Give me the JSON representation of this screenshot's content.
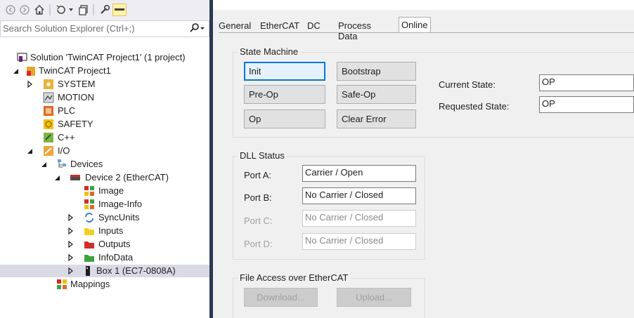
{
  "explorer": {
    "search_placeholder": "Search Solution Explorer (Ctrl+;)",
    "toolbar_icons": [
      "back-icon",
      "forward-icon",
      "home-icon",
      "sync-icon",
      "dropdown-arrow-icon",
      "show-all-files-icon",
      "properties-icon",
      "preview-icon"
    ],
    "tree": [
      {
        "label": "Solution 'TwinCAT Project1' (1 project)",
        "icon": "solution-icon",
        "arrow": "none"
      },
      {
        "label": "TwinCAT Project1",
        "icon": "twincat-project-icon",
        "arrow": "expanded"
      },
      {
        "label": "SYSTEM",
        "icon": "system-icon",
        "arrow": "collapsed"
      },
      {
        "label": "MOTION",
        "icon": "motion-icon",
        "arrow": "none"
      },
      {
        "label": "PLC",
        "icon": "plc-icon",
        "arrow": "none"
      },
      {
        "label": "SAFETY",
        "icon": "safety-icon",
        "arrow": "none"
      },
      {
        "label": "C++",
        "icon": "cpp-icon",
        "arrow": "none"
      },
      {
        "label": "I/O",
        "icon": "io-icon",
        "arrow": "expanded"
      },
      {
        "label": "Devices",
        "icon": "devices-icon",
        "arrow": "expanded"
      },
      {
        "label": "Device 2 (EtherCAT)",
        "icon": "ethercat-device-icon",
        "arrow": "expanded"
      },
      {
        "label": "Image",
        "icon": "image-icon",
        "arrow": "none"
      },
      {
        "label": "Image-Info",
        "icon": "image-info-icon",
        "arrow": "none"
      },
      {
        "label": "SyncUnits",
        "icon": "syncunits-icon",
        "arrow": "collapsed"
      },
      {
        "label": "Inputs",
        "icon": "inputs-icon",
        "arrow": "collapsed"
      },
      {
        "label": "Outputs",
        "icon": "outputs-icon",
        "arrow": "collapsed"
      },
      {
        "label": "InfoData",
        "icon": "infodata-icon",
        "arrow": "collapsed"
      },
      {
        "label": "Box 1 (EC7-0808A)",
        "icon": "box-icon",
        "arrow": "collapsed",
        "selected": true
      },
      {
        "label": "Mappings",
        "icon": "mappings-icon",
        "arrow": "none"
      }
    ]
  },
  "tabs": [
    "General",
    "EtherCAT",
    "DC",
    "Process Data",
    "Online"
  ],
  "active_tab": "Online",
  "state_machine": {
    "title": "State Machine",
    "buttons": {
      "init": "Init",
      "bootstrap": "Bootstrap",
      "preop": "Pre-Op",
      "safeop": "Safe-Op",
      "op": "Op",
      "clear_error": "Clear Error"
    },
    "current_state_label": "Current State:",
    "current_state": "OP",
    "requested_state_label": "Requested State:",
    "requested_state": "OP"
  },
  "dll_status": {
    "title": "DLL Status",
    "ports": [
      {
        "label": "Port A:",
        "value": "Carrier / Open",
        "enabled": true
      },
      {
        "label": "Port B:",
        "value": "No Carrier / Closed",
        "enabled": true
      },
      {
        "label": "Port C:",
        "value": "No Carrier / Closed",
        "enabled": false
      },
      {
        "label": "Port D:",
        "value": "No Carrier / Closed",
        "enabled": false
      }
    ]
  },
  "file_access": {
    "title": "File Access over EtherCAT",
    "download": "Download...",
    "upload": "Upload..."
  },
  "colors": {
    "splitter": "#293955",
    "focus_border": "#0078d7",
    "selection": "#dadae6"
  }
}
